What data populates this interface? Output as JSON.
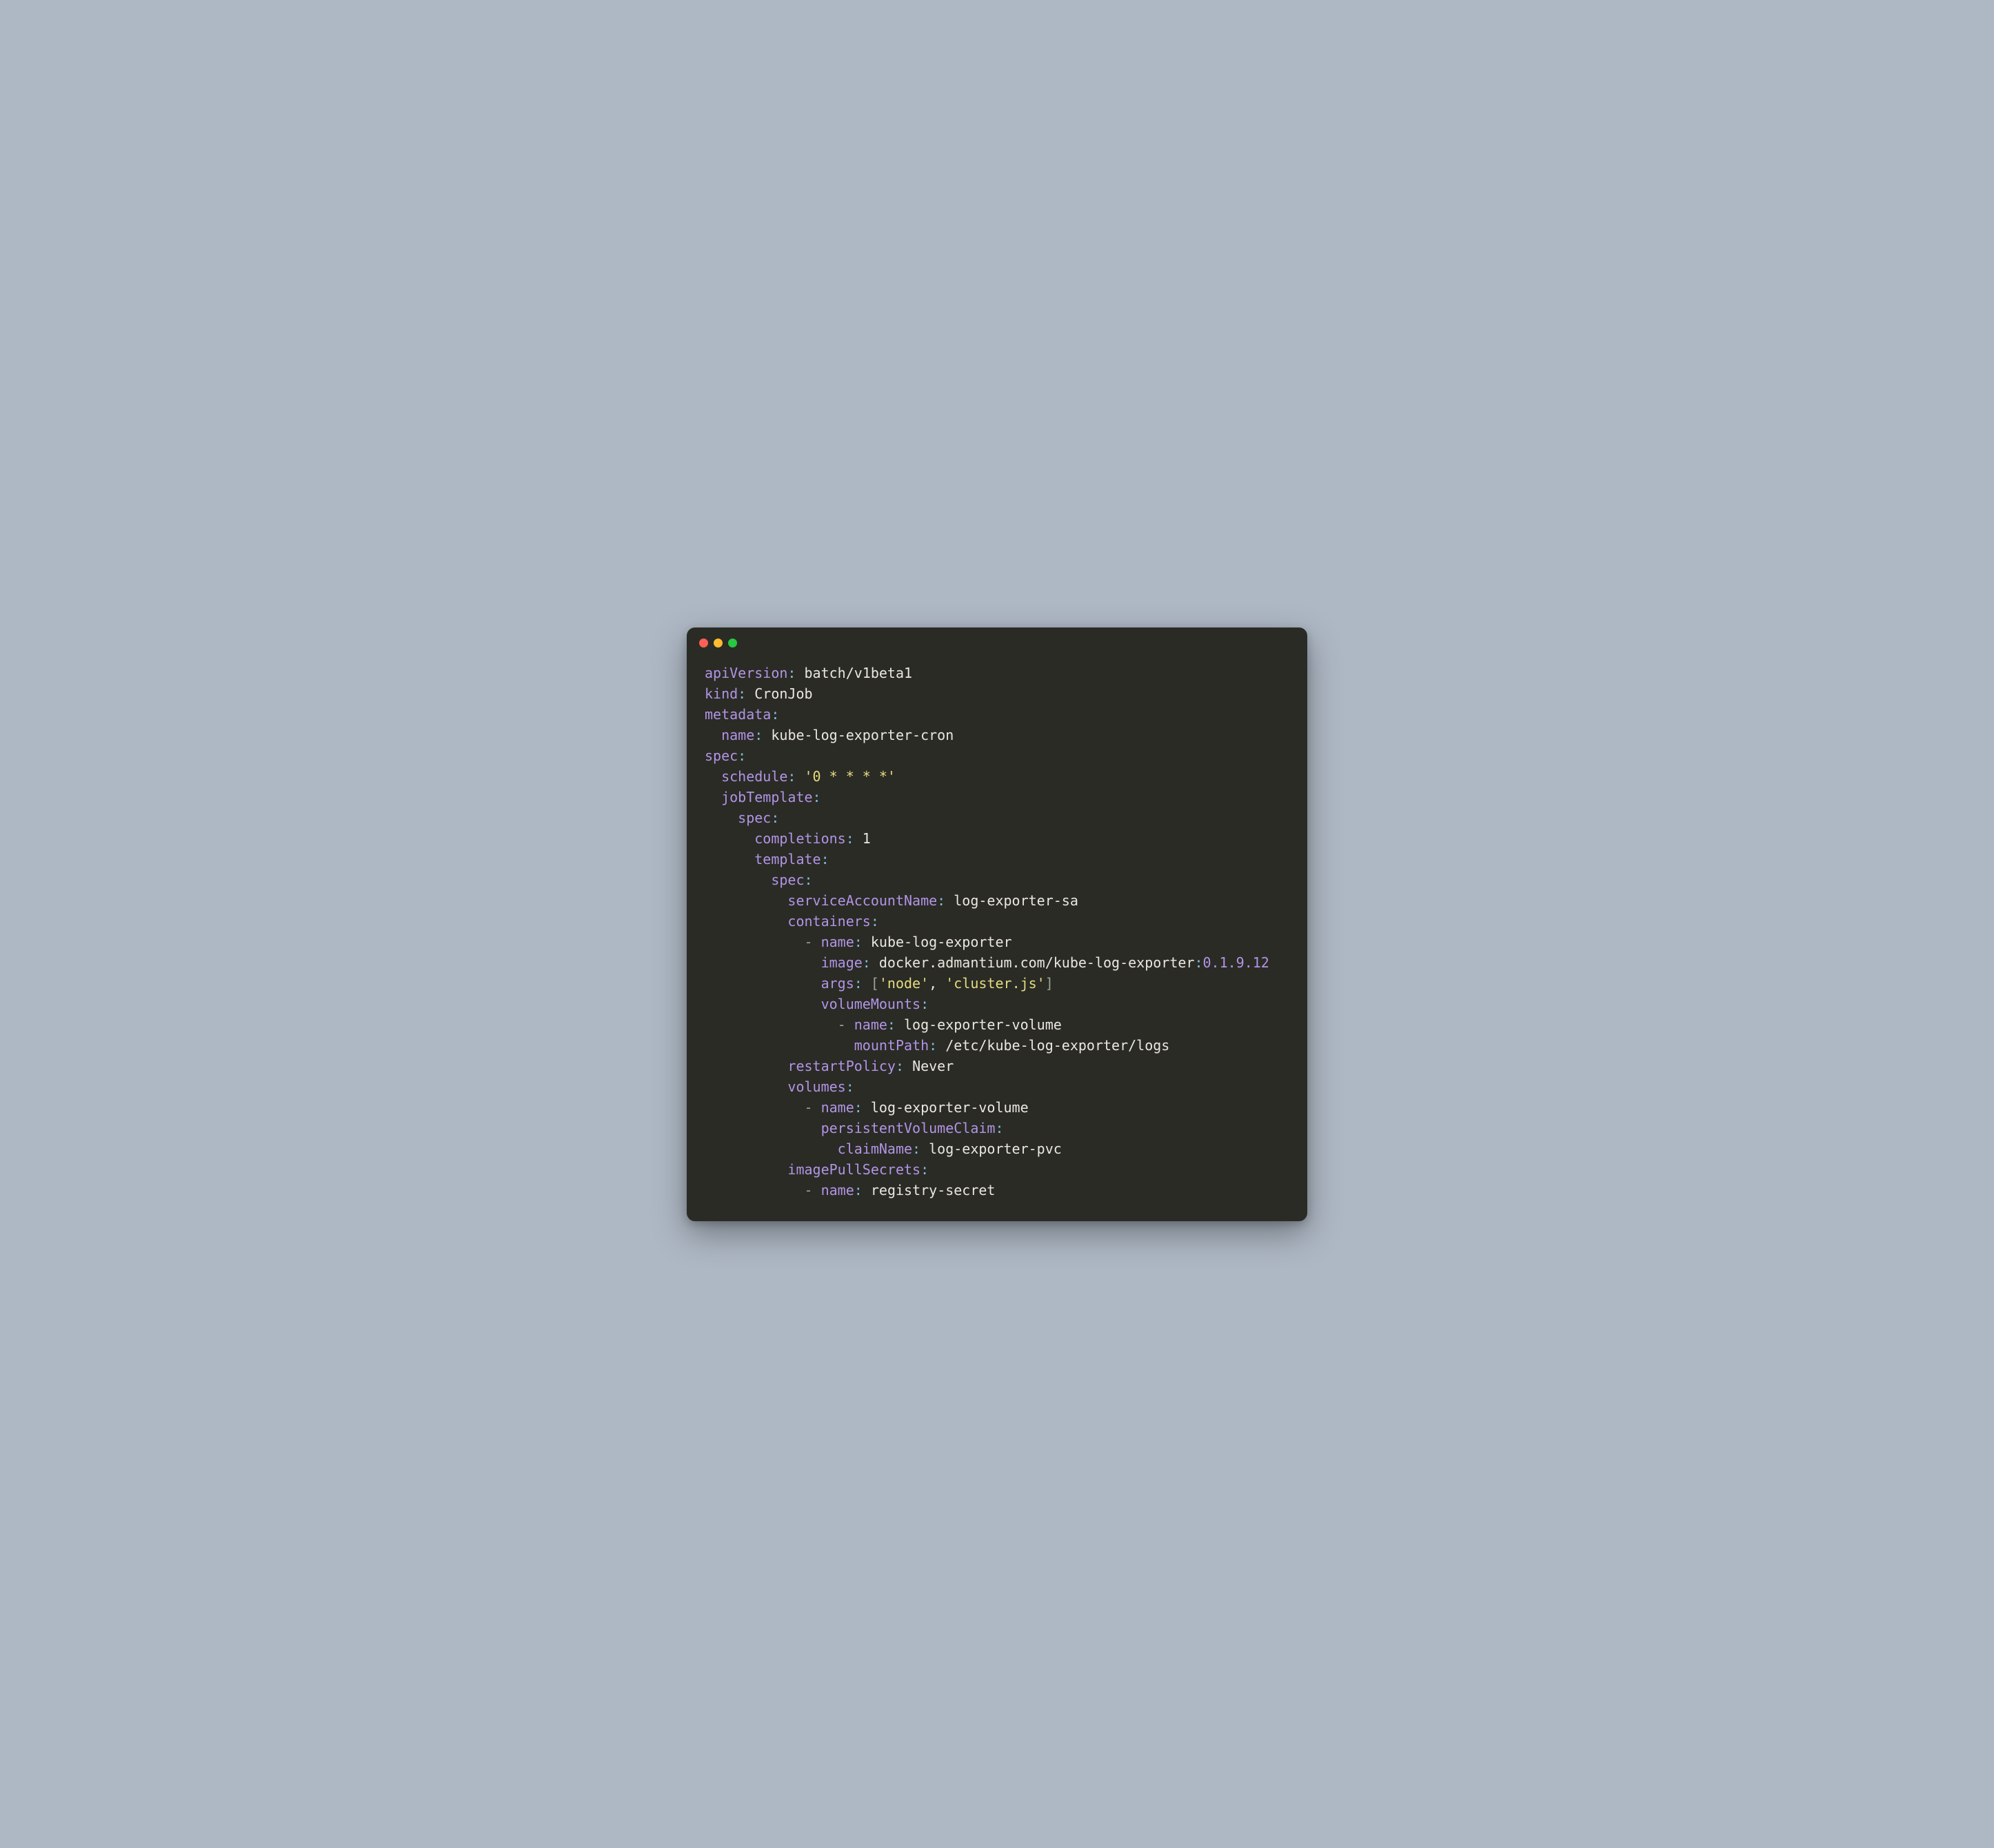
{
  "yaml": {
    "apiVersion": {
      "key": "apiVersion",
      "value": "batch/v1beta1"
    },
    "kind": {
      "key": "kind",
      "value": "CronJob"
    },
    "metadata": {
      "key": "metadata"
    },
    "metadata_name": {
      "key": "name",
      "value": "kube-log-exporter-cron"
    },
    "spec": {
      "key": "spec"
    },
    "schedule": {
      "key": "schedule",
      "value": "'0 * * * *'"
    },
    "jobTemplate": {
      "key": "jobTemplate"
    },
    "jt_spec": {
      "key": "spec"
    },
    "completions": {
      "key": "completions",
      "value": "1"
    },
    "template": {
      "key": "template"
    },
    "t_spec": {
      "key": "spec"
    },
    "serviceAccountName": {
      "key": "serviceAccountName",
      "value": "log-exporter-sa"
    },
    "containers": {
      "key": "containers"
    },
    "c_name": {
      "key": "name",
      "value": "kube-log-exporter"
    },
    "c_image": {
      "key": "image",
      "value_pre": "docker.admantium.com/kube-log-exporter",
      "colon2": ":",
      "value_post": "0.1.9.12"
    },
    "c_args": {
      "key": "args",
      "arg1": "'node'",
      "comma": ",",
      "arg2": "'cluster.js'"
    },
    "volumeMounts": {
      "key": "volumeMounts"
    },
    "vm_name": {
      "key": "name",
      "value": "log-exporter-volume"
    },
    "vm_mountPath": {
      "key": "mountPath",
      "value": "/etc/kube-log-exporter/logs"
    },
    "restartPolicy": {
      "key": "restartPolicy",
      "value": "Never"
    },
    "volumes": {
      "key": "volumes"
    },
    "vol_name": {
      "key": "name",
      "value": "log-exporter-volume"
    },
    "pvc": {
      "key": "persistentVolumeClaim"
    },
    "claimName": {
      "key": "claimName",
      "value": "log-exporter-pvc"
    },
    "imagePullSecrets": {
      "key": "imagePullSecrets"
    },
    "ips_name": {
      "key": "name",
      "value": "registry-secret"
    }
  },
  "punct": {
    "colon": ":",
    "dash": "-",
    "lbrack": "[",
    "rbrack": "]"
  }
}
